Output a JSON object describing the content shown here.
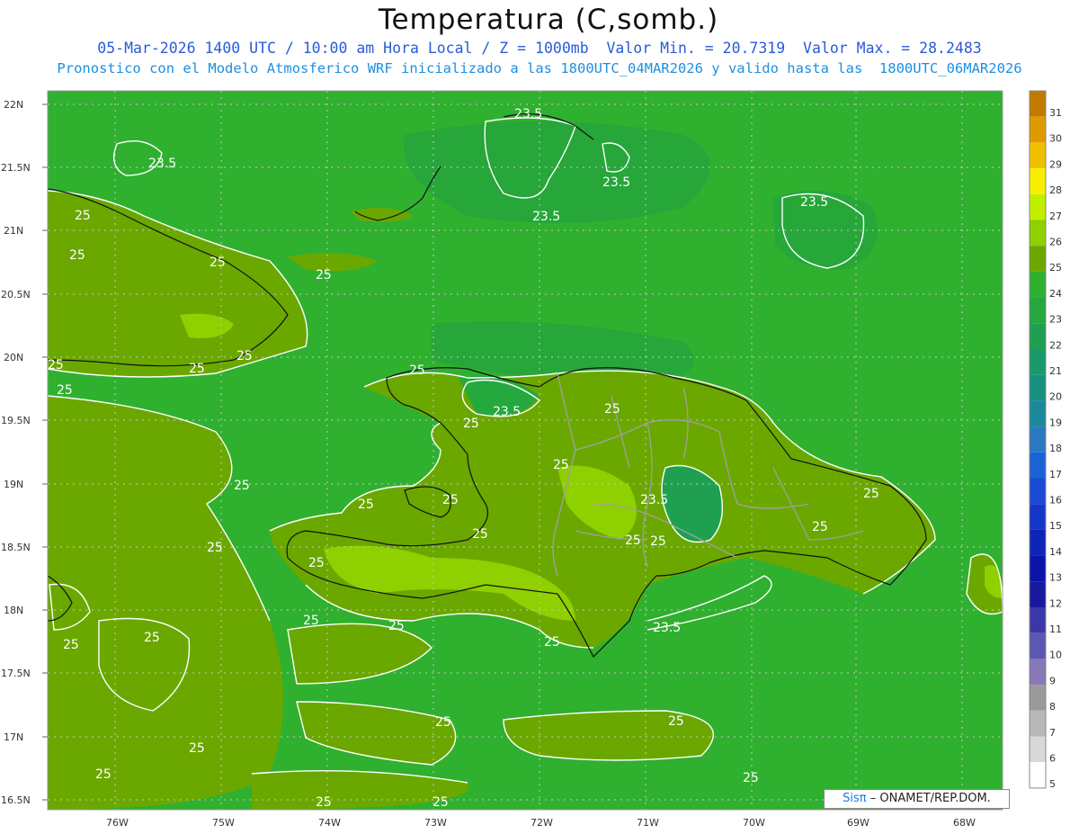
{
  "header": {
    "title": "Temperatura (C,somb.)",
    "line1": "05-Mar-2026 1400 UTC / 10:00 am Hora Local / Z = 1000mb  Valor Min. = 20.7319  Valor Max. = 28.2483",
    "line2": "Pronostico con el Modelo Atmosferico WRF inicializado a las 1800UTC_04MAR2026 y valido hasta las  1800UTC_06MAR2026"
  },
  "axes": {
    "lat_labels": [
      "22N",
      "21.5N",
      "21N",
      "20.5N",
      "20N",
      "19.5N",
      "19N",
      "18.5N",
      "18N",
      "17.5N",
      "17N",
      "16.5N"
    ],
    "lon_labels": [
      "76W",
      "75W",
      "74W",
      "73W",
      "72W",
      "71W",
      "70W",
      "69W",
      "68W"
    ]
  },
  "colorbar": {
    "labels": [
      "31",
      "30",
      "29",
      "28",
      "27",
      "26",
      "25",
      "24",
      "23",
      "22",
      "21",
      "20",
      "19",
      "18",
      "17",
      "16",
      "15",
      "14",
      "13",
      "12",
      "11",
      "10",
      "9",
      "8",
      "7",
      "6",
      "5"
    ],
    "colors": [
      "#c07a00",
      "#e09a00",
      "#f0c000",
      "#f8f000",
      "#c0f000",
      "#8ed000",
      "#6aa800",
      "#2fb02f",
      "#25a83e",
      "#1fa050",
      "#1a9a6a",
      "#189080",
      "#1a8a9a",
      "#2a78c0",
      "#1a62d8",
      "#1a4ad6",
      "#1436c8",
      "#0c24b8",
      "#0a14a8",
      "#1818a0",
      "#3a38a8",
      "#5a58b0",
      "#8878b8",
      "#9a9a9a",
      "#b8b8b8",
      "#d8d8d8",
      "#ffffff"
    ]
  },
  "contour_labels": [
    "23.5",
    "25"
  ],
  "credit": {
    "brand": "Sisπ",
    "text": "– ONAMET/REP.DOM."
  }
}
